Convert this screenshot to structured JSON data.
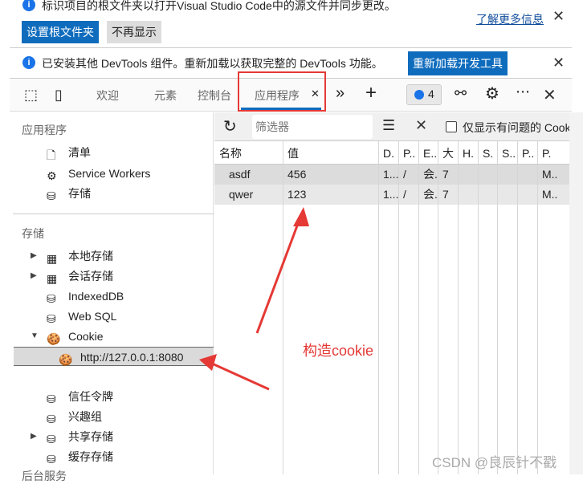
{
  "banner1": {
    "text": "标识项目的根文件夹以打开Visual Studio Code中的源文件并同步更改。",
    "set_root": "设置根文件夹",
    "dont_show": "不再显示",
    "learn_more": "了解更多信息"
  },
  "banner2": {
    "text": "已安装其他 DevTools 组件。重新加载以获取完整的 DevTools 功能。",
    "reload": "重新加载开发工具"
  },
  "tabs": [
    {
      "label": "欢迎"
    },
    {
      "label": "元素"
    },
    {
      "label": "控制台"
    },
    {
      "label": "应用程序",
      "active": true
    }
  ],
  "issues_count": "4",
  "sidebar": {
    "app_header": "应用程序",
    "app_items": [
      {
        "label": "清单",
        "icon": "file-icon"
      },
      {
        "label": "Service Workers",
        "icon": "gear-icon"
      },
      {
        "label": "存储",
        "icon": "database-icon"
      }
    ],
    "storage_header": "存储",
    "storage_items": [
      {
        "label": "本地存储",
        "icon": "grid-icon",
        "expand": "collapsed"
      },
      {
        "label": "会话存储",
        "icon": "grid-icon",
        "expand": "collapsed"
      },
      {
        "label": "IndexedDB",
        "icon": "database-icon"
      },
      {
        "label": "Web SQL",
        "icon": "database-icon"
      },
      {
        "label": "Cookie",
        "icon": "cookie-icon",
        "expand": "expanded"
      },
      {
        "label": "http://127.0.0.1:8080",
        "icon": "cookie-icon",
        "selected": true
      },
      {
        "label": "信任令牌",
        "icon": "database-icon"
      },
      {
        "label": "兴趣组",
        "icon": "database-icon"
      },
      {
        "label": "共享存储",
        "icon": "database-icon",
        "expand": "collapsed"
      },
      {
        "label": "缓存存储",
        "icon": "database-icon"
      }
    ],
    "bg_header": "后台服务"
  },
  "toolbar": {
    "filter_placeholder": "筛选器",
    "only_issues": "仅显示有问题的 Cookie"
  },
  "table": {
    "headers": [
      "名称",
      "值",
      "D.",
      "P..",
      "E..",
      "大",
      "H.",
      "S.",
      "S..",
      "P..",
      "P."
    ],
    "rows": [
      [
        "asdf",
        "456",
        "1...",
        "/",
        "会.",
        "7",
        "",
        "",
        "",
        "",
        "M.."
      ],
      [
        "qwer",
        "123",
        "1...",
        "/",
        "会.",
        "7",
        "",
        "",
        "",
        "",
        "M.."
      ]
    ]
  },
  "annotation": "构造cookie",
  "watermark": "CSDN @良辰针不戳",
  "colors": {
    "accent": "#0f6cbd",
    "highlight": "#e53935"
  }
}
